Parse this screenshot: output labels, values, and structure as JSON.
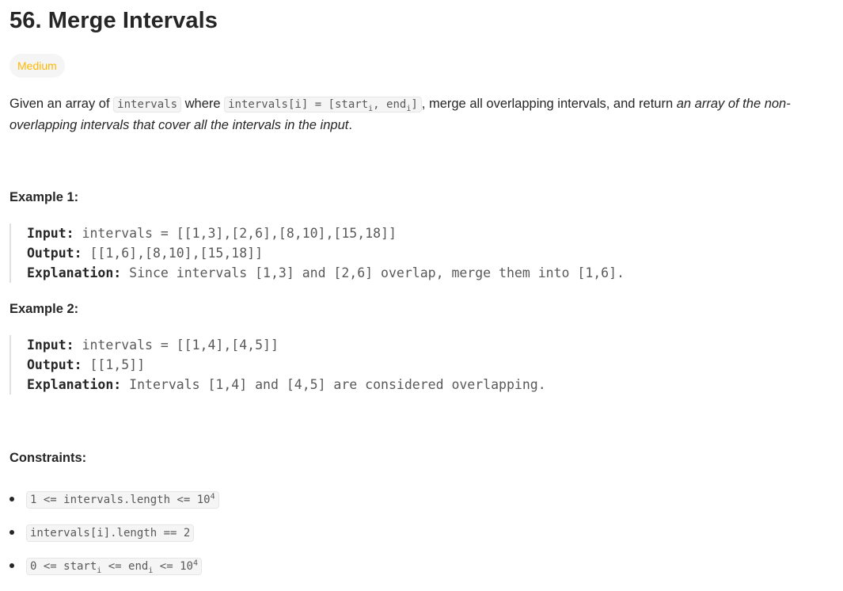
{
  "problem": {
    "title": "56. Merge Intervals",
    "difficulty": "Medium",
    "difficulty_color": "#ffb800"
  },
  "description": {
    "part1": "Given an array of ",
    "code1": "intervals",
    "part2": " where ",
    "code2_main": "intervals[i] = [start",
    "code2_sub1": "i",
    "code2_mid": ", end",
    "code2_sub2": "i",
    "code2_end": "]",
    "part3": ", merge all overlapping intervals, and return ",
    "italic": "an array of the non-overlapping intervals that cover all the intervals in the input",
    "part4": "."
  },
  "examples": [
    {
      "heading": "Example 1:",
      "input_label": "Input:",
      "input_value": " intervals = [[1,3],[2,6],[8,10],[15,18]]",
      "output_label": "Output:",
      "output_value": " [[1,6],[8,10],[15,18]]",
      "explanation_label": "Explanation:",
      "explanation_value": " Since intervals [1,3] and [2,6] overlap, merge them into [1,6]."
    },
    {
      "heading": "Example 2:",
      "input_label": "Input:",
      "input_value": " intervals = [[1,4],[4,5]]",
      "output_label": "Output:",
      "output_value": " [[1,5]]",
      "explanation_label": "Explanation:",
      "explanation_value": " Intervals [1,4] and [4,5] are considered overlapping."
    }
  ],
  "constraints": {
    "heading": "Constraints:",
    "c1_main": "1 <= intervals.length <= 10",
    "c1_sup": "4",
    "c2": "intervals[i].length == 2",
    "c3_a": "0 <= start",
    "c3_sub1": "i",
    "c3_b": " <= end",
    "c3_sub2": "i",
    "c3_c": " <= 10",
    "c3_sup": "4"
  }
}
